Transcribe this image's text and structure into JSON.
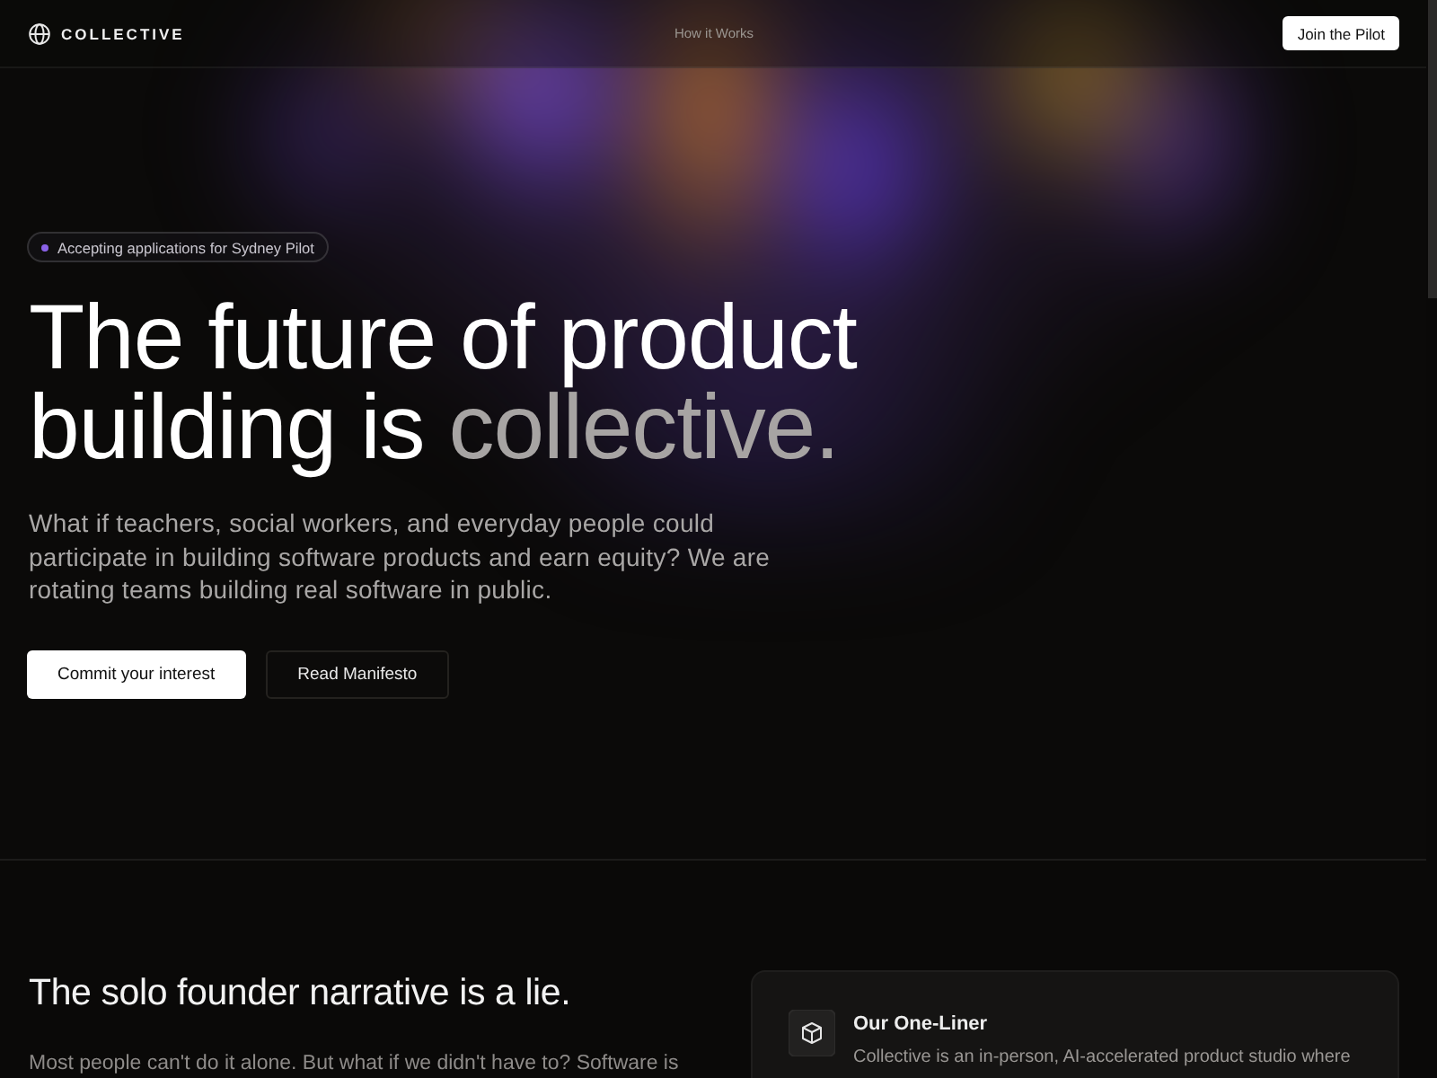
{
  "nav": {
    "brand": "COLLECTIVE",
    "links": [
      {
        "label": "How it Works"
      }
    ],
    "cta": "Join the Pilot"
  },
  "hero": {
    "badge": "Accepting applications for Sydney Pilot",
    "headline": "The future of product building is",
    "headline_highlight": "collective.",
    "description": "What if teachers, social workers, and everyday people could participate in building software products and earn equity? We are rotating teams building real software in public.",
    "buttons": [
      {
        "label": "Commit your interest",
        "kind": "primary"
      },
      {
        "label": "Read Manifesto",
        "kind": "secondary"
      }
    ]
  },
  "section": {
    "heading": "The solo founder narrative is a lie.",
    "body": "Most people can't do it alone. But what if we didn't have to? Software is",
    "card": {
      "title": "Our One-Liner",
      "body": "Collective is an in-person, AI-accelerated product studio where"
    }
  }
}
